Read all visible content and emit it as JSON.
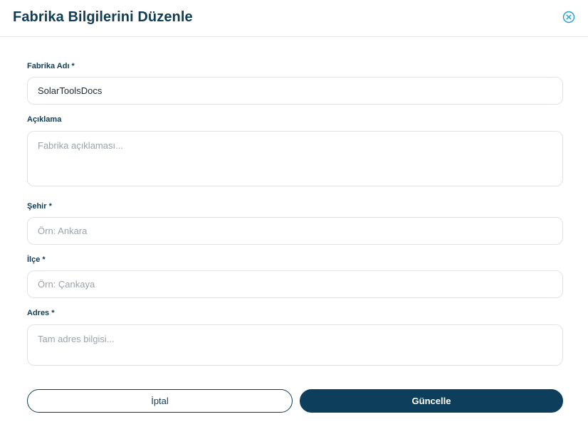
{
  "modal": {
    "title": "Fabrika Bilgilerini Düzenle"
  },
  "colors": {
    "primary": "#0d3f5c",
    "close_icon": "#1aa3c4",
    "border": "#dfe3e7"
  },
  "icons": {
    "close": "close-circle-icon"
  },
  "form": {
    "factory_name": {
      "label": "Fabrika Adı *",
      "value": "SolarToolsDocs"
    },
    "description": {
      "label": "Açıklama",
      "placeholder": "Fabrika açıklaması..."
    },
    "city": {
      "label": "Şehir *",
      "placeholder": "Örn: Ankara"
    },
    "district": {
      "label": "İlçe *",
      "placeholder": "Örn: Çankaya"
    },
    "address": {
      "label": "Adres *",
      "placeholder": "Tam adres bilgisi..."
    }
  },
  "actions": {
    "cancel_label": "İptal",
    "submit_label": "Güncelle"
  }
}
